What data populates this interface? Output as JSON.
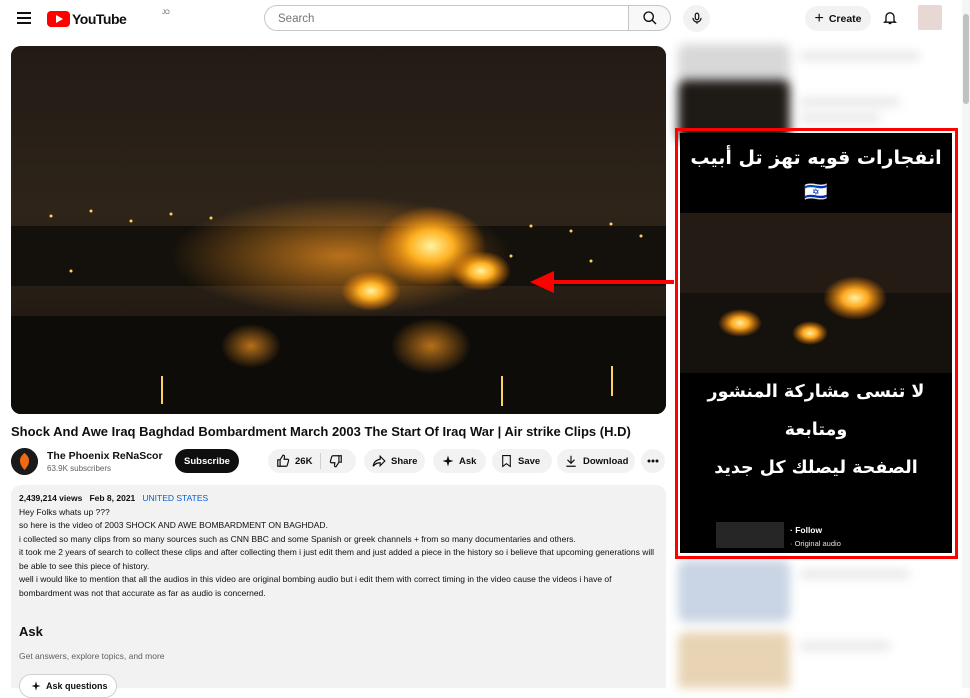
{
  "header": {
    "logo_text": "YouTube",
    "country_code": "JO",
    "search_placeholder": "Search",
    "create_label": "Create"
  },
  "video": {
    "title": "Shock And Awe Iraq Baghdad Bombardment March 2003 The Start Of Iraq War | Air strike Clips (H.D)",
    "channel_name": "The Phoenix ReNaScor",
    "subscribers": "63.9K subscribers",
    "subscribe_label": "Subscribe",
    "likes": "26K",
    "share_label": "Share",
    "ask_label": "Ask",
    "save_label": "Save",
    "download_label": "Download"
  },
  "description": {
    "views": "2,439,214 views",
    "date": "Feb 8, 2021",
    "location": "UNITED STATES",
    "lines": [
      "Hey Folks whats up ???",
      "so here is the video of 2003 SHOCK AND AWE BOMBARDMENT ON BAGHDAD.",
      "i collected so many clips from so many sources such as CNN BBC and some Spanish or greek channels + from so many documentaries and others.",
      "it took me 2 years of search to collect these clips and after collecting them i just edit them and just added a piece in the history so i believe that upcoming generations will be able to see this piece of history.",
      "well i would like to mention that all the audios in this video are original bombing audio but i edit them with correct timing in the video cause the videos i have of bombardment was not that accurate as far as audio is concerned."
    ]
  },
  "ask_section": {
    "title": "Ask",
    "subtitle": "Get answers, explore topics, and more",
    "button_label": "Ask questions"
  },
  "reel": {
    "title_line1": "انفجارات قويه تهز تل أبيب 🇮🇱",
    "title_line2": "🚀🇮🇷",
    "caption_line1": "لا تنسى مشاركة المنشور ومتابعة",
    "caption_line2": "الصفحة ليصلك كل جديد",
    "follow_label": "· Follow",
    "audio_label": "· Original audio"
  },
  "colors": {
    "brand_red": "#ff0000",
    "link_blue": "#065fd4",
    "annotation_red": "#ff0000"
  }
}
